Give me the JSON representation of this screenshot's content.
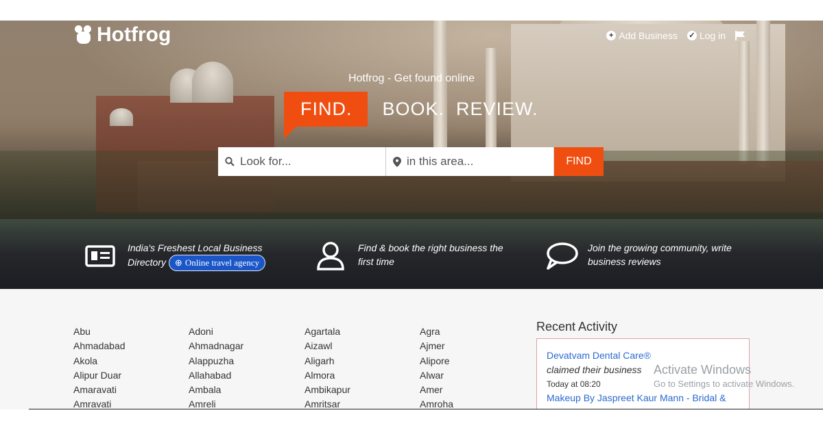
{
  "header": {
    "brand": "Hotfrog",
    "nav": [
      {
        "label": "Add Business",
        "icon": "plus-circle-icon"
      },
      {
        "label": "Log in",
        "icon": "chevron-circle-icon"
      }
    ]
  },
  "hero": {
    "tagline": "Hotfrog - Get found online",
    "find_word": "FIND.",
    "book_review": "BOOK.  REVIEW."
  },
  "search": {
    "what_placeholder": "Look for...",
    "where_placeholder": "in this area...",
    "button_label": "FIND"
  },
  "features": [
    {
      "line1": "India's Freshest Local Business",
      "line2": "Directory",
      "badge": "Online travel agency",
      "icon": "id-card-icon"
    },
    {
      "line1": "Find & book the right business the",
      "line2": "first time",
      "icon": "user-icon"
    },
    {
      "line1": "Join the growing community, write",
      "line2": "business reviews",
      "icon": "speech-bubble-icon"
    }
  ],
  "cities": [
    [
      "Abu",
      "Ahmadabad",
      "Akola",
      "Alipur Duar",
      "Amaravati",
      "Amravati"
    ],
    [
      "Adoni",
      "Ahmadnagar",
      "Alappuzha",
      "Allahabad",
      "Ambala",
      "Amreli"
    ],
    [
      "Agartala",
      "Aizawl",
      "Aligarh",
      "Almora",
      "Ambikapur",
      "Amritsar"
    ],
    [
      "Agra",
      "Ajmer",
      "Alipore",
      "Alwar",
      "Amer",
      "Amroha"
    ]
  ],
  "recent_activity": {
    "title": "Recent Activity",
    "items": [
      {
        "business": "Devatvam Dental Care®",
        "action": "claimed their business",
        "time": "Today at 08:20"
      },
      {
        "business": "Makeup By Jaspreet Kaur Mann - Bridal &"
      }
    ]
  },
  "watermark": {
    "line1": "Activate Windows",
    "line2": "Go to Settings to activate Windows."
  },
  "colors": {
    "accent": "#f04e10",
    "link": "#2a6ad0",
    "badge": "#1a56c7"
  }
}
